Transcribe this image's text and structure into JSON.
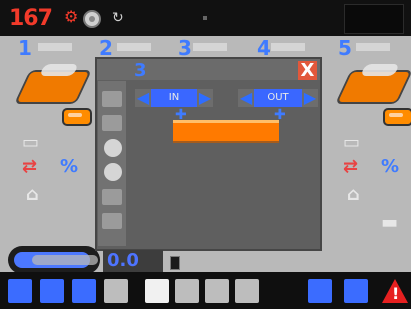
{
  "top": {
    "counter": "167",
    "counter_icon": "red-wrench-icon",
    "gear_icon": "gear-icon",
    "refresh_icon": "refresh-icon"
  },
  "stations": [
    {
      "num": "1"
    },
    {
      "num": "2"
    },
    {
      "num": "3"
    },
    {
      "num": "4"
    },
    {
      "num": "5"
    }
  ],
  "dialog": {
    "title": "3",
    "close": "X",
    "left_value": "IN",
    "right_value": "OUT",
    "left_arrow": "◀",
    "right_arrow": "▶"
  },
  "status": {
    "value": "0.0"
  },
  "colors": {
    "accent_blue": "#3f7bff",
    "orange": "#ff7a00",
    "danger_red": "#e62020",
    "panel_gray": "#b9b9b9",
    "dialog_gray": "#5f5f5f"
  }
}
